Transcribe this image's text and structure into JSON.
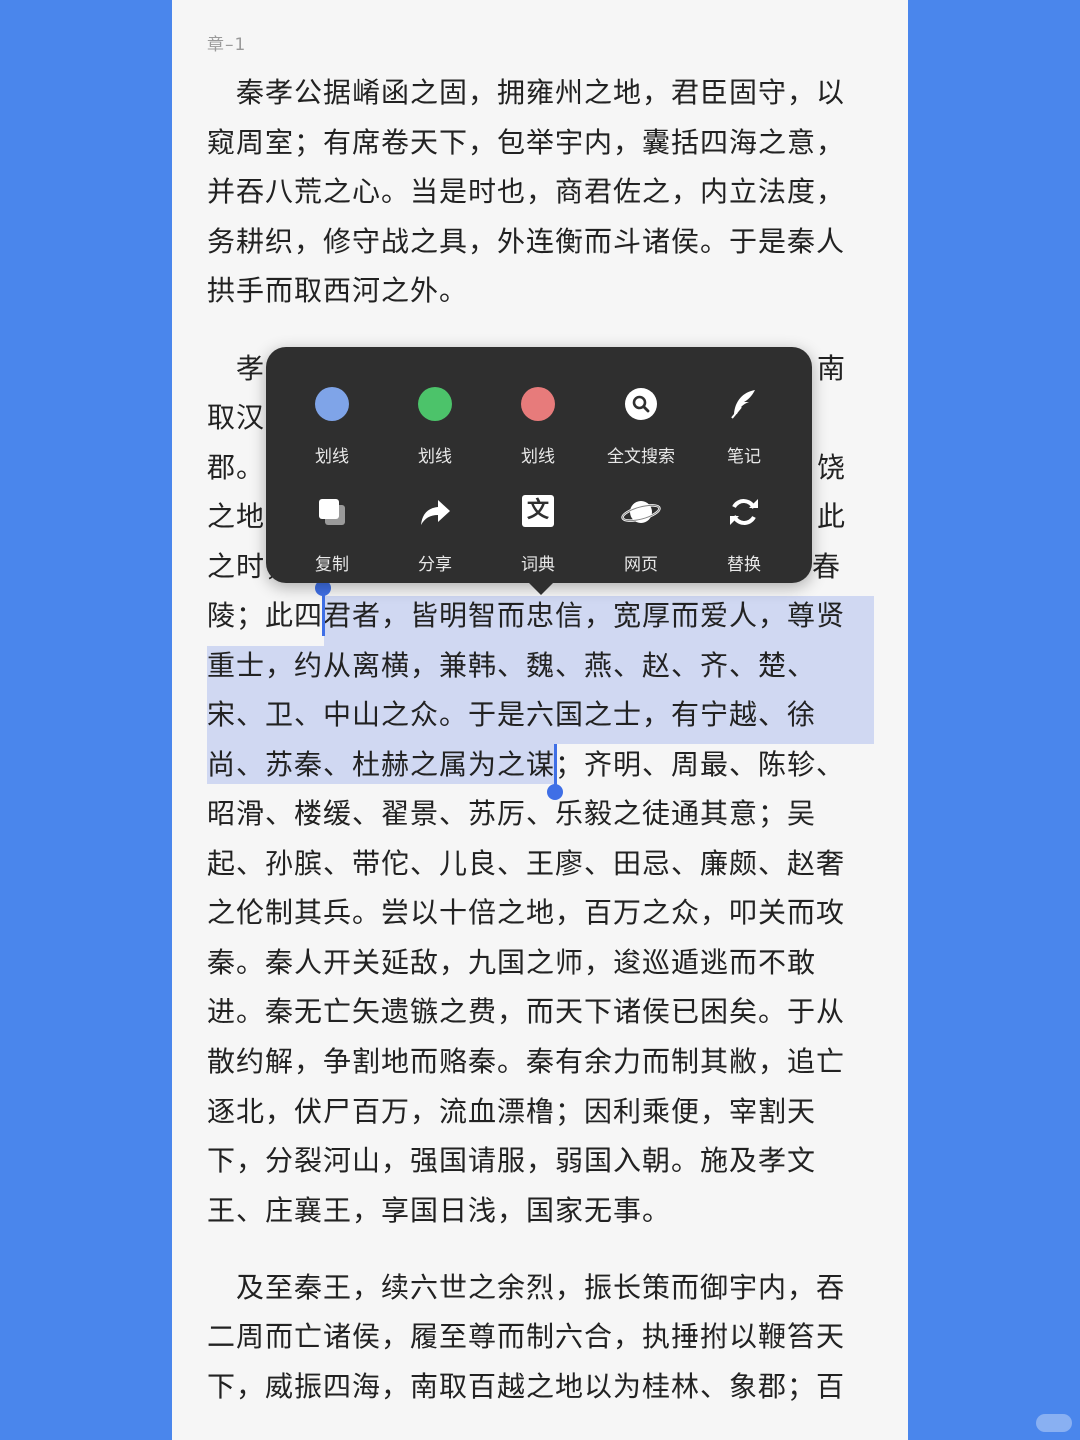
{
  "chapter": "章–1",
  "paragraph1": [
    "　秦孝公据崤函之固，拥雍州之地，君臣固守，以",
    "窥周室；有席卷天下，包举宇内，囊括四海之意，",
    "并吞八荒之心。当是时也，商君佐之，内立法度，",
    "务耕织，修守战之具，外连衡而斗诸侯。于是秦人",
    "拱手而取西河之外。"
  ],
  "paragraph2_left": [
    "　孝",
    "取汉",
    "郡。",
    "之地",
    "之时，"
  ],
  "paragraph2_right": [
    "南",
    "",
    "饶",
    "此",
    "春"
  ],
  "paragraph2": [
    "陵；此四君者，皆明智而忠信，宽厚而爱人，尊贤",
    "重士，约从离横，兼韩、魏、燕、赵、齐、楚、",
    "宋、卫、中山之众。于是六国之士，有宁越、徐",
    "尚、苏秦、杜赫之属为之谋；齐明、周最、陈轸、",
    "昭滑、楼缓、翟景、苏厉、乐毅之徒通其意；吴",
    "起、孙膑、带佗、儿良、王廖、田忌、廉颇、赵奢",
    "之伦制其兵。尝以十倍之地，百万之众，叩关而攻",
    "秦。秦人开关延敌，九国之师，逡巡遁逃而不敢",
    "进。秦无亡矢遗镞之费，而天下诸侯已困矣。于从",
    "散约解，争割地而赂秦。秦有余力而制其敝，追亡",
    "逐北，伏尸百万，流血漂橹；因利乘便，宰割天",
    "下，分裂河山，强国请服，弱国入朝。施及孝文",
    "王、庄襄王，享国日浅，国家无事。"
  ],
  "paragraph3": [
    "　及至秦王，续六世之余烈，振长策而御宇内，吞",
    "二周而亡诸侯，履至尊而制六合，执捶拊以鞭笞天",
    "下，威振四海，南取百越之地以为桂林、象郡；百"
  ],
  "menu": {
    "row1": [
      {
        "label": "划线",
        "icon": "blue-dot-icon",
        "color": "#7fa4e8"
      },
      {
        "label": "划线",
        "icon": "green-dot-icon",
        "color": "#4cc36a"
      },
      {
        "label": "划线",
        "icon": "red-dot-icon",
        "color": "#e77b7b"
      },
      {
        "label": "全文搜索",
        "icon": "search-icon"
      },
      {
        "label": "笔记",
        "icon": "feather-icon"
      }
    ],
    "row2": [
      {
        "label": "复制",
        "icon": "copy-icon"
      },
      {
        "label": "分享",
        "icon": "share-icon"
      },
      {
        "label": "词典",
        "icon": "dictionary-icon",
        "glyph": "文"
      },
      {
        "label": "网页",
        "icon": "planet-icon"
      },
      {
        "label": "替换",
        "icon": "replace-icon"
      }
    ]
  }
}
